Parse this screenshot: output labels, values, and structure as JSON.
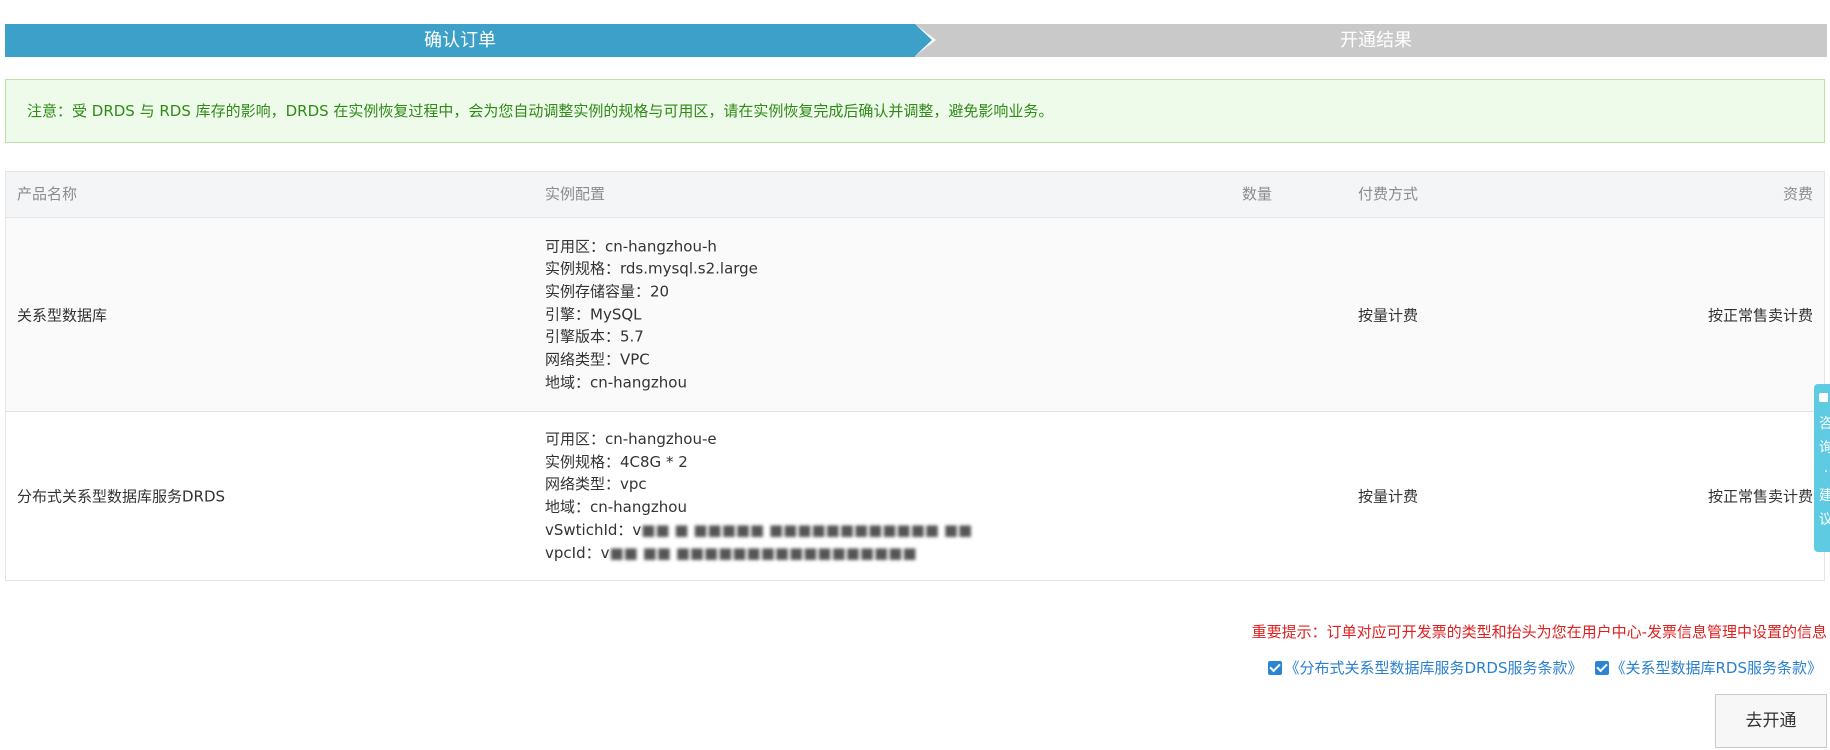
{
  "steps": {
    "current": "确认订单",
    "next": "开通结果"
  },
  "notice": {
    "text": "注意：受 DRDS 与 RDS 库存的影响，DRDS 在实例恢复过程中，会为您自动调整实例的规格与可用区，请在实例恢复完成后确认并调整，避免影响业务。"
  },
  "table": {
    "headers": {
      "name": "产品名称",
      "config": "实例配置",
      "qty": "数量",
      "pay": "付费方式",
      "fee": "资费"
    },
    "rows": [
      {
        "name": "关系型数据库",
        "config": [
          "可用区：cn-hangzhou-h",
          "实例规格：rds.mysql.s2.large",
          "实例存储容量：20",
          "引擎：MySQL",
          "引擎版本：5.7",
          "网络类型：VPC",
          "地域：cn-hangzhou"
        ],
        "qty": "",
        "pay": "按量计费",
        "fee": "按正常售卖计费"
      },
      {
        "name": "分布式关系型数据库服务DRDS",
        "config": [
          "可用区：cn-hangzhou-e",
          "实例规格：4C8G * 2",
          "网络类型：vpc",
          "地域：cn-hangzhou",
          "vSwtichId：v",
          "vpcId：v"
        ],
        "qty": "",
        "pay": "按量计费",
        "fee": "按正常售卖计费"
      }
    ]
  },
  "important": {
    "text": "重要提示：订单对应可开发票的类型和抬头为您在用户中心-发票信息管理中设置的信息"
  },
  "agreements": [
    {
      "label": "《分布式关系型数据库服务DRDS服务条款》",
      "checked": true
    },
    {
      "label": "《关系型数据库RDS服务条款》",
      "checked": true
    }
  ],
  "submit": {
    "label": "去开通"
  },
  "side_tab": {
    "text": "咨询·建议"
  },
  "colors": {
    "step_active": "#3da0c9",
    "step_inactive": "#c9c9c9",
    "notice_bg": "#eefbea",
    "notice_text": "#2f8a17",
    "important_text": "#e02020",
    "link": "#2a7fd0",
    "side_tab": "#5ecbe2"
  }
}
